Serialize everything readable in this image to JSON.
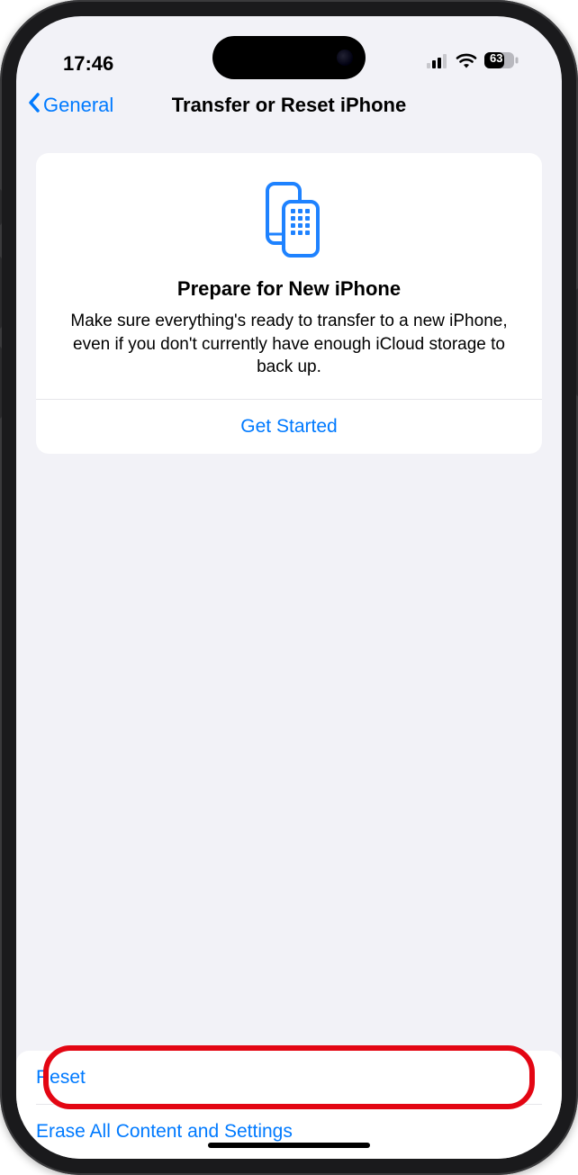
{
  "status": {
    "time": "17:46",
    "battery": "63"
  },
  "nav": {
    "back": "General",
    "title": "Transfer or Reset iPhone"
  },
  "prepare_card": {
    "title": "Prepare for New iPhone",
    "description": "Make sure everything's ready to transfer to a new iPhone, even if you don't currently have enough iCloud storage to back up.",
    "action": "Get Started"
  },
  "actions": {
    "reset": "Reset",
    "erase": "Erase All Content and Settings"
  }
}
